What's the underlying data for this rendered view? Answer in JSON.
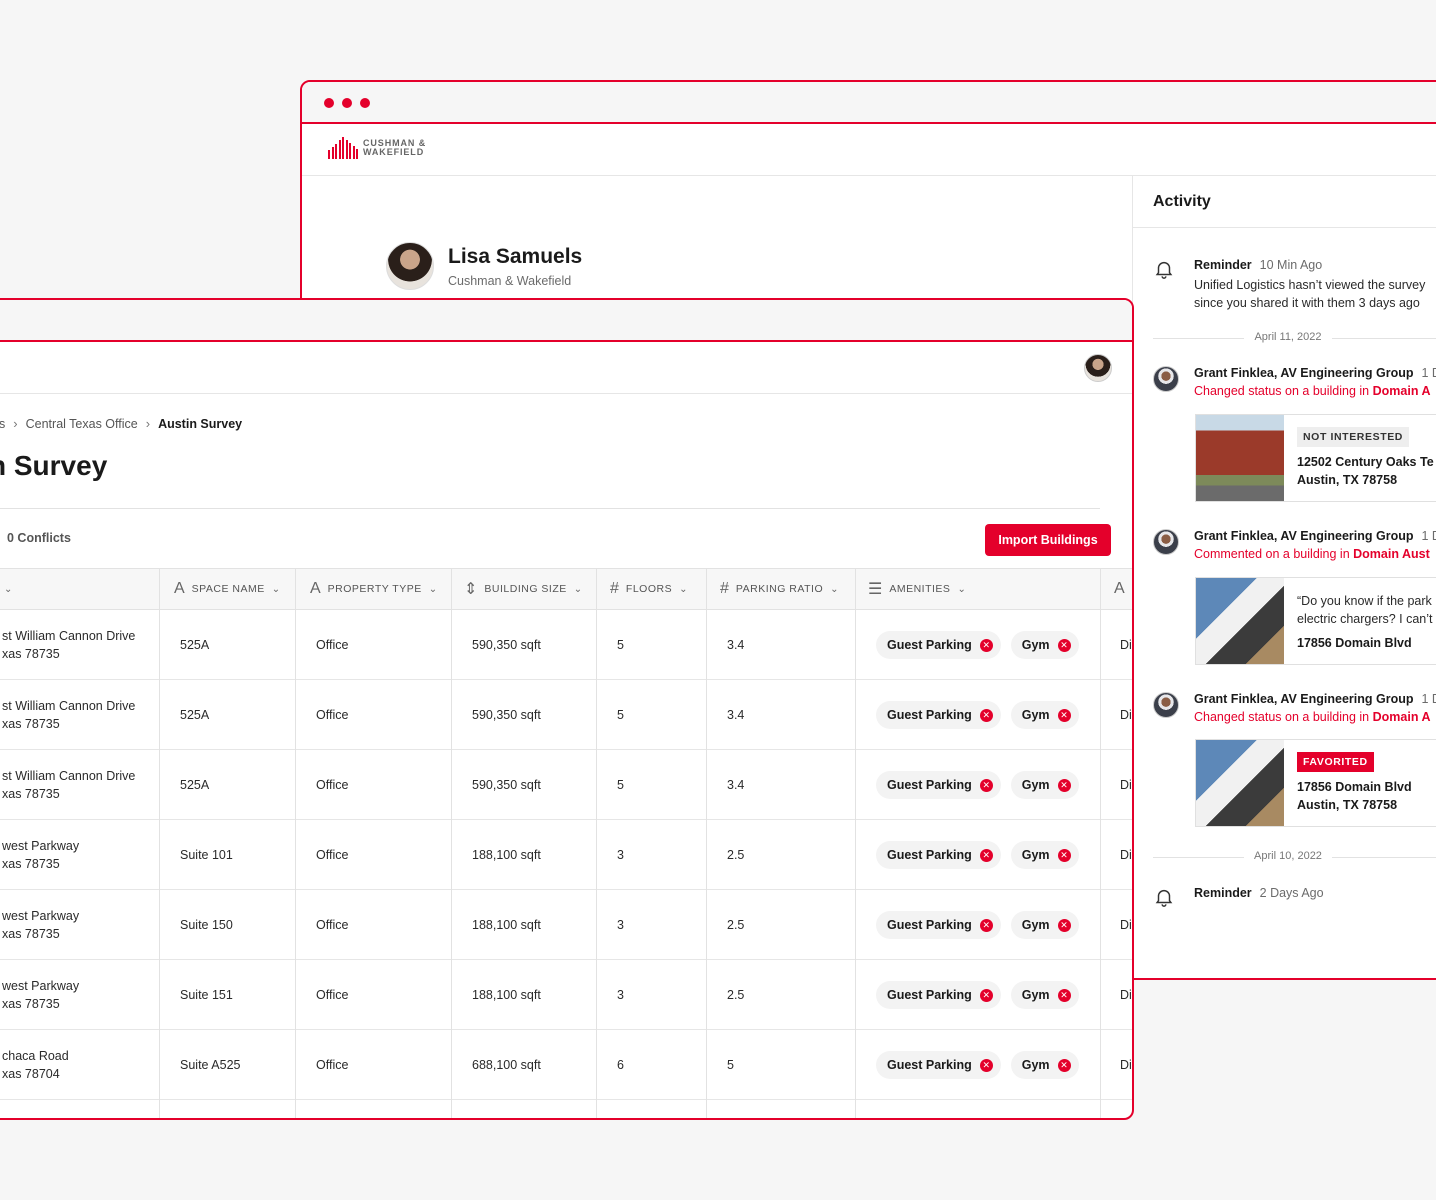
{
  "colors": {
    "accent": "#e4002b",
    "background": "#f6f6f6"
  },
  "back_window": {
    "logo": {
      "line1": "CUSHMAN &",
      "line2": "WAKEFIELD"
    },
    "profile": {
      "name": "Lisa Samuels",
      "company": "Cushman & Wakefield"
    },
    "activity": {
      "title": "Activity",
      "reminder1": {
        "label": "Reminder",
        "time": "10 Min Ago",
        "line1": "Unified Logistics hasn’t viewed the survey",
        "line2": "since you shared it with them 3 days ago"
      },
      "date1": "April 11, 2022",
      "item1": {
        "who": "Grant Finklea, AV Engineering Group",
        "time": "1 D",
        "action": "Changed status on a building in",
        "target": "Domain A",
        "badge": "NOT INTERESTED",
        "line1": "12502 Century Oaks Te",
        "line2": "Austin, TX 78758"
      },
      "item2": {
        "who": "Grant Finklea, AV Engineering Group",
        "time": "1 D",
        "action": "Commented on a building in",
        "target": "Domain Aust",
        "quote1": "“Do you know if the park",
        "quote2": "electric chargers? I can’t",
        "line1": "17856 Domain Blvd"
      },
      "item3": {
        "who": "Grant Finklea, AV Engineering Group",
        "time": "1 D",
        "action": "Changed status on a building in",
        "target": "Domain A",
        "badge": "FAVORITED",
        "line1": "17856 Domain Blvd",
        "line2": "Austin, TX 78758"
      },
      "date2": "April 10, 2022",
      "reminder2": {
        "label": "Reminder",
        "time": "2 Days Ago"
      }
    }
  },
  "front_window": {
    "breadcrumb": {
      "first": "ics",
      "second": "Central Texas Office",
      "current": "Austin Survey"
    },
    "title": "n Survey",
    "conflicts": "0 Conflicts",
    "import_label": "Import Buildings",
    "columns": {
      "space_name": "SPACE NAME",
      "property_type": "PROPERTY TYPE",
      "building_size": "BUILDING SIZE",
      "floors": "FLOORS",
      "parking_ratio": "PARKING RATIO",
      "amenities": "AMENITIES",
      "next_icon": "A"
    },
    "rows": [
      {
        "addr1": "st William Cannon Drive",
        "addr2": "xas 78735",
        "space": "525A",
        "type": "Office",
        "size": "590,350 sqft",
        "floors": "5",
        "ratio": "3.4",
        "amenity1": "Guest Parking",
        "amenity2": "Gym",
        "next": "Di"
      },
      {
        "addr1": "st William Cannon Drive",
        "addr2": "xas 78735",
        "space": "525A",
        "type": "Office",
        "size": "590,350 sqft",
        "floors": "5",
        "ratio": "3.4",
        "amenity1": "Guest Parking",
        "amenity2": "Gym",
        "next": "Di"
      },
      {
        "addr1": "st William Cannon Drive",
        "addr2": "xas 78735",
        "space": "525A",
        "type": "Office",
        "size": "590,350 sqft",
        "floors": "5",
        "ratio": "3.4",
        "amenity1": "Guest Parking",
        "amenity2": "Gym",
        "next": "Di"
      },
      {
        "addr1": "west Parkway",
        "addr2": "xas 78735",
        "space": "Suite 101",
        "type": "Office",
        "size": "188,100 sqft",
        "floors": "3",
        "ratio": "2.5",
        "amenity1": "Guest Parking",
        "amenity2": "Gym",
        "next": "Di"
      },
      {
        "addr1": "west Parkway",
        "addr2": "xas 78735",
        "space": "Suite 150",
        "type": "Office",
        "size": "188,100 sqft",
        "floors": "3",
        "ratio": "2.5",
        "amenity1": "Guest Parking",
        "amenity2": "Gym",
        "next": "Di"
      },
      {
        "addr1": "west Parkway",
        "addr2": "xas 78735",
        "space": "Suite 151",
        "type": "Office",
        "size": "188,100 sqft",
        "floors": "3",
        "ratio": "2.5",
        "amenity1": "Guest Parking",
        "amenity2": "Gym",
        "next": "Di"
      },
      {
        "addr1": "chaca Road",
        "addr2": "xas 78704",
        "space": "Suite A525",
        "type": "Office",
        "size": "688,100 sqft",
        "floors": "6",
        "ratio": "5",
        "amenity1": "Guest Parking",
        "amenity2": "Gym",
        "next": "Di"
      }
    ]
  }
}
